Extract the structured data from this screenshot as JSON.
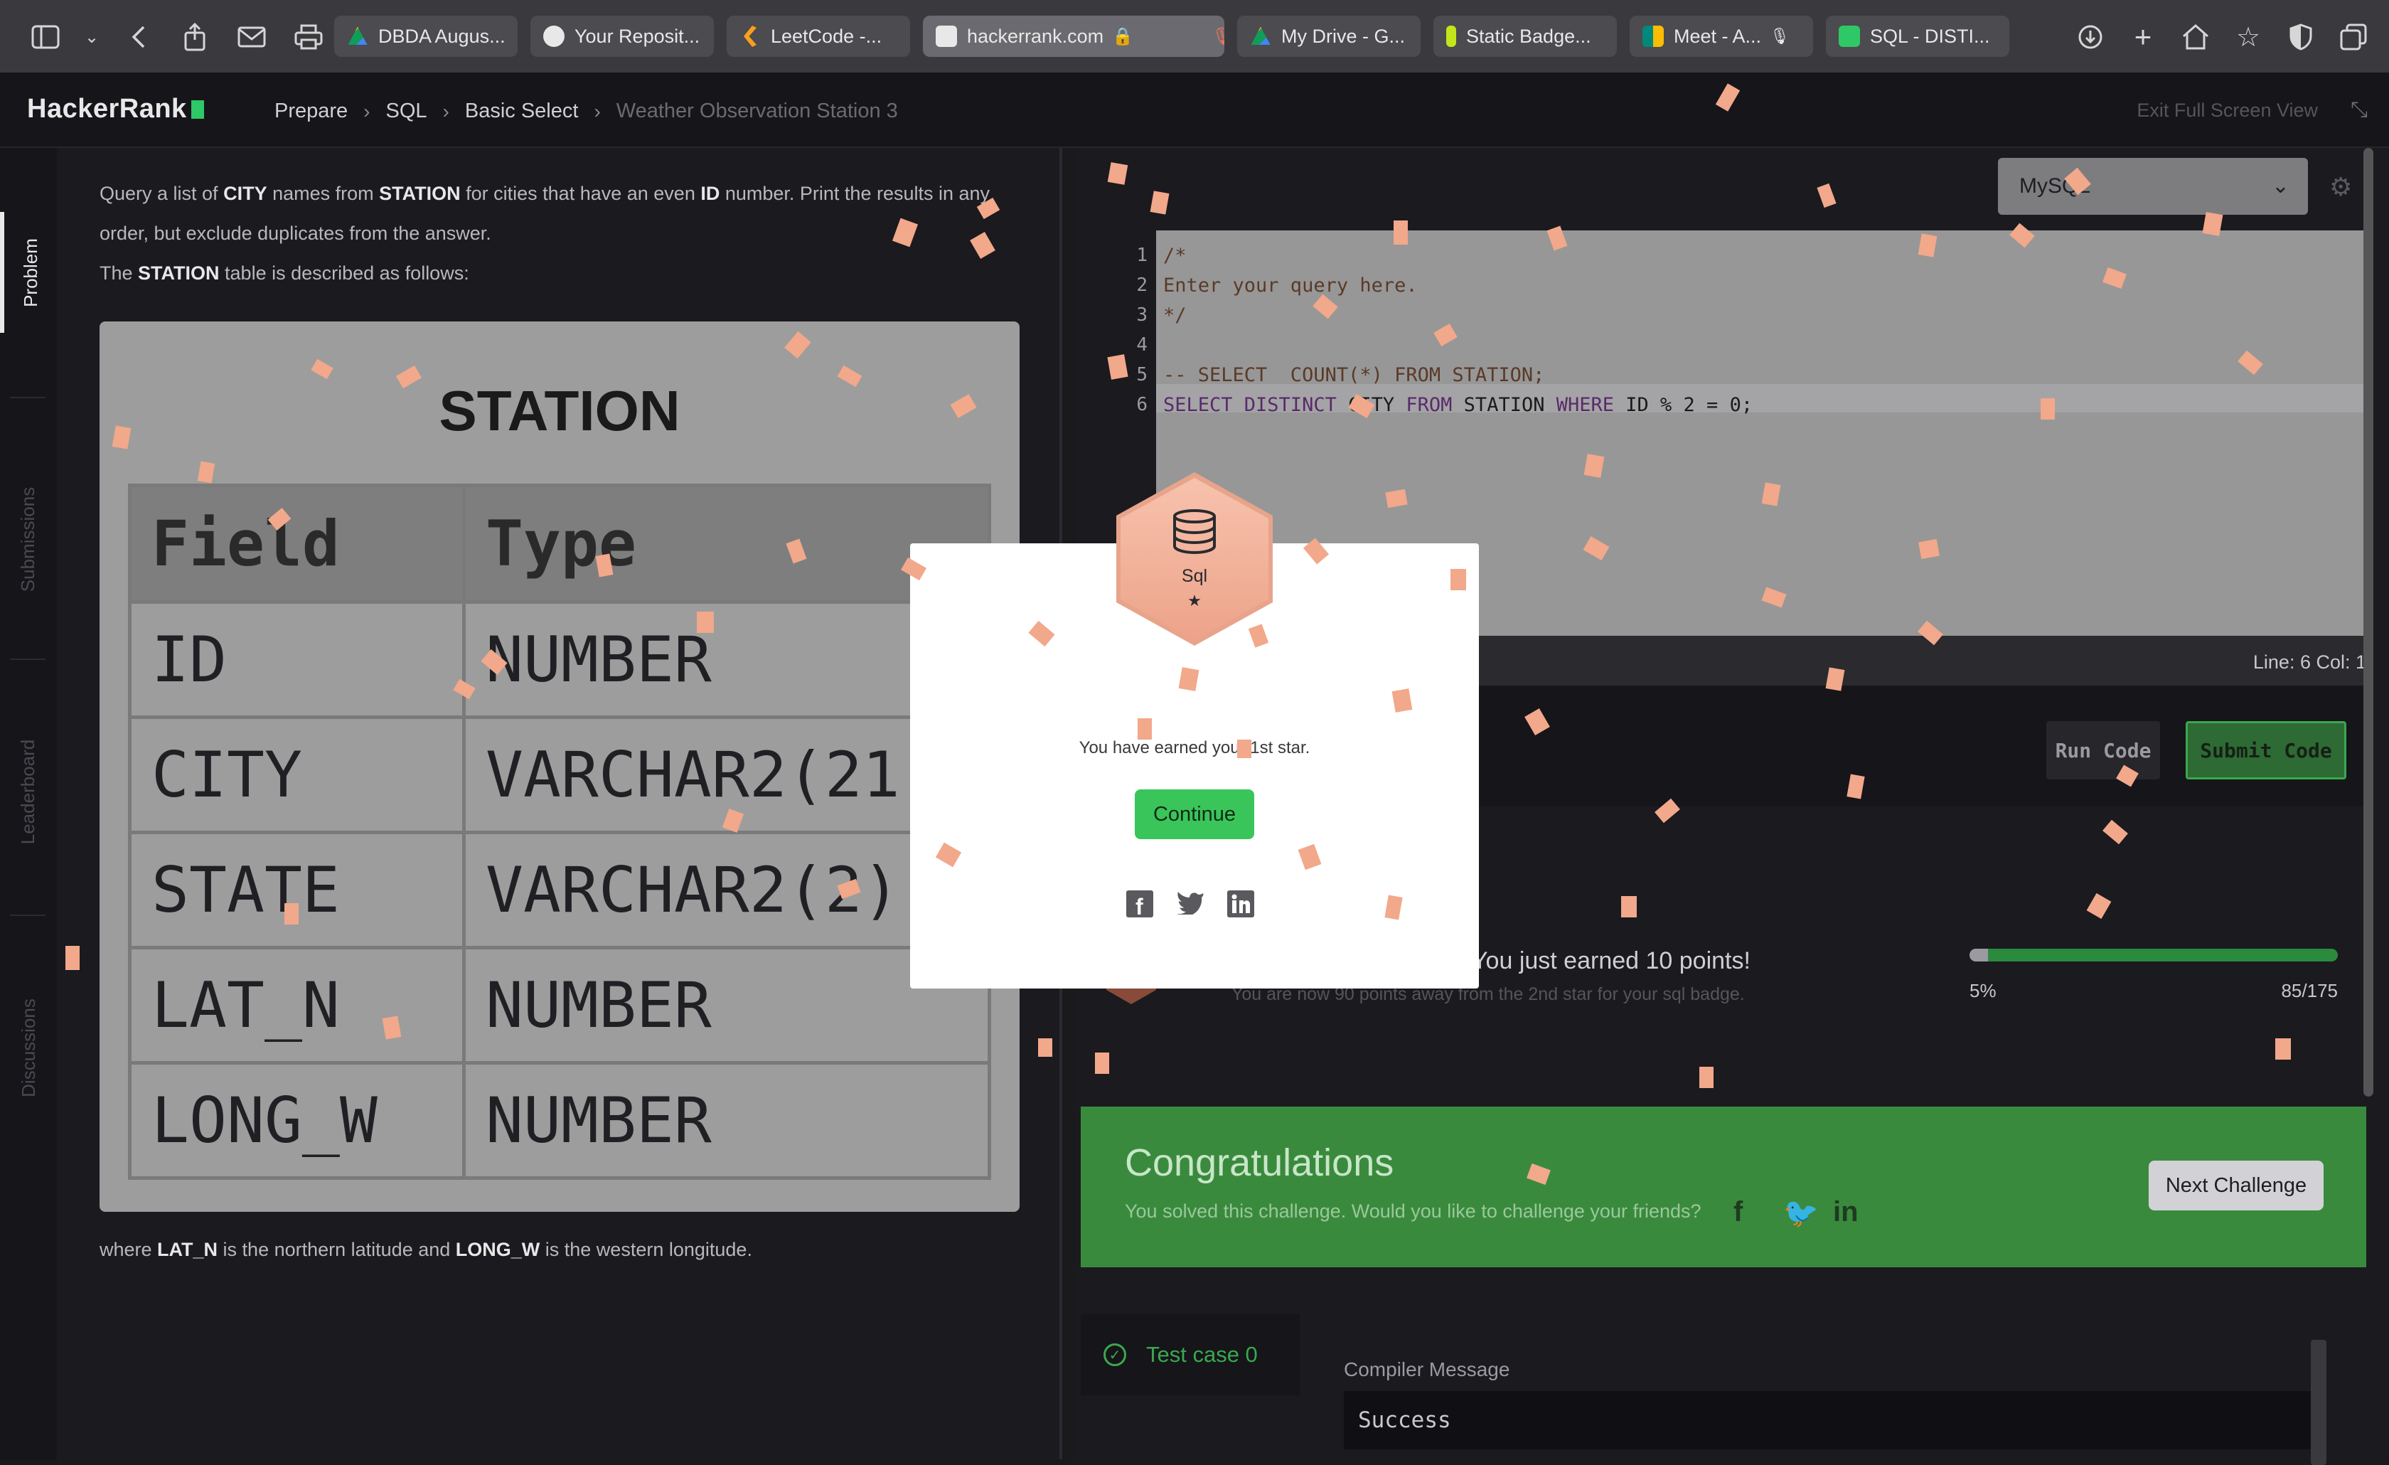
{
  "browser": {
    "tabs": [
      {
        "label": "DBDA Augus...",
        "color": "#f4b400"
      },
      {
        "label": "Your Reposit...",
        "color": "#e8e8e8"
      },
      {
        "label": "LeetCode -...",
        "color": "#f89f1b"
      },
      {
        "label": "hackerrank.com",
        "color": "#e8e8e8"
      },
      {
        "label": "My Drive - G...",
        "color": "#1fa463"
      },
      {
        "label": "Static Badge...",
        "color": "#c3e61a"
      },
      {
        "label": "Meet - A...",
        "color": "#00897b"
      },
      {
        "label": "SQL - DISTI...",
        "color": "#2ec866"
      }
    ]
  },
  "header": {
    "logo": "HackerRank",
    "breadcrumbs": [
      "Prepare",
      "SQL",
      "Basic Select"
    ],
    "current": "Weather Observation Station 3",
    "exit_fullscreen": "Exit Full Screen View"
  },
  "sidebar": {
    "items": [
      "Problem",
      "Submissions",
      "Leaderboard",
      "Discussions"
    ]
  },
  "problem": {
    "p1_a": "Query a list of ",
    "p1_city": "CITY",
    "p1_b": " names from ",
    "p1_station": "STATION",
    "p1_c": " for cities that have an even ",
    "p1_id": "ID",
    "p1_d": " number. Print the results in any",
    "p2": "order, but exclude duplicates from the answer.",
    "p3_a": "The ",
    "p3_station": "STATION",
    "p3_b": " table is described as follows:",
    "table_title": "STATION",
    "table_headers": [
      "Field",
      "Type"
    ],
    "table_rows": [
      [
        "ID",
        "NUMBER"
      ],
      [
        "CITY",
        "VARCHAR2(21)"
      ],
      [
        "STATE",
        "VARCHAR2(2)"
      ],
      [
        "LAT_N",
        "NUMBER"
      ],
      [
        "LONG_W",
        "NUMBER"
      ]
    ],
    "note_a": "where ",
    "note_latn": "LAT_N",
    "note_b": " is the northern latitude and ",
    "note_longw": "LONG_W",
    "note_c": " is the western longitude."
  },
  "editor": {
    "language": "MySQL",
    "line_numbers": [
      "1",
      "2",
      "3",
      "4",
      "5",
      "6"
    ],
    "line1": "/*",
    "line2": "Enter your query here.",
    "line3": "*/",
    "line5": "-- SELECT  COUNT(*) FROM STATION;",
    "line6_kw1": "SELECT DISTINCT",
    "line6_id1": " CITY ",
    "line6_kw2": "FROM",
    "line6_id2": " STATION ",
    "line6_kw3": "WHERE",
    "line6_rest": " ID % 2 = 0;",
    "status": "Line: 6 Col: 1",
    "run_label": "Run Code",
    "submit_label": "Submit Code"
  },
  "progress": {
    "title": "You just earned 10 points!",
    "subtitle": "You are now 90 points away from the 2nd star for your sql badge.",
    "left_label": "5%",
    "right_label": "85/175",
    "fraction": 0.05
  },
  "congrats": {
    "title": "Congratulations",
    "message": "You solved this challenge. Would you like to challenge your friends?",
    "next_label": "Next Challenge"
  },
  "results": {
    "test_case": "Test case 0",
    "compiler_label": "Compiler Message",
    "compiler_value": "Success"
  },
  "modal": {
    "badge_label": "Sql",
    "badge_star": "★",
    "message": "You have earned your 1st star.",
    "continue_label": "Continue"
  }
}
